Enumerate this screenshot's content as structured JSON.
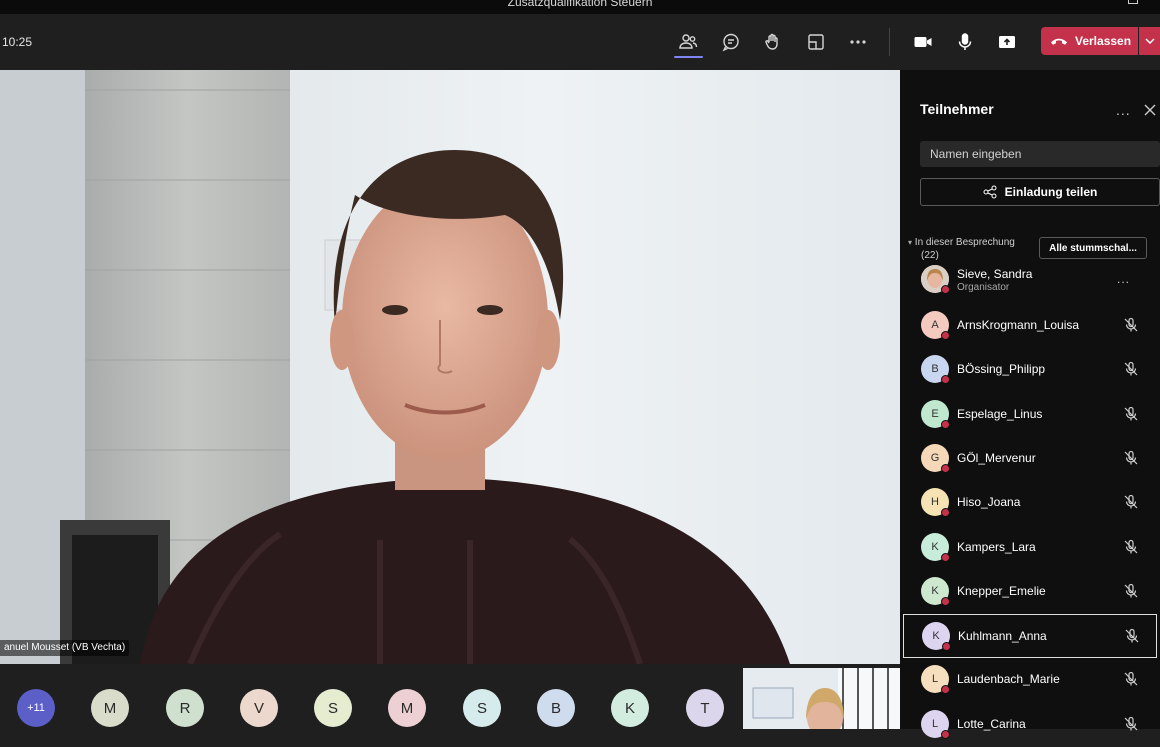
{
  "window": {
    "title": "Zusatzqualifikation Steuern"
  },
  "toolbar": {
    "timer": "10:25",
    "leave_label": "Verlassen",
    "icons": [
      "people-icon",
      "chat-icon",
      "raise-hand-icon",
      "rooms-icon",
      "more-icon",
      "camera-icon",
      "mic-icon",
      "share-icon"
    ]
  },
  "video": {
    "speaker_name": "anuel Mousset (VB Vechta)"
  },
  "strip": {
    "more_label": "+11",
    "avatars": [
      {
        "initial": "M",
        "color": "#d9dccb"
      },
      {
        "initial": "R",
        "color": "#cfe0cf"
      },
      {
        "initial": "V",
        "color": "#ecd8cc"
      },
      {
        "initial": "S",
        "color": "#e6ecd0"
      },
      {
        "initial": "M",
        "color": "#ecd0d4"
      },
      {
        "initial": "S",
        "color": "#d6ecec"
      },
      {
        "initial": "B",
        "color": "#cfdced"
      },
      {
        "initial": "K",
        "color": "#d3ece0"
      },
      {
        "initial": "T",
        "color": "#dcd6ec"
      }
    ]
  },
  "panel": {
    "title": "Teilnehmer",
    "more": "...",
    "search_placeholder": "Namen eingeben",
    "invite_label": "Einladung teilen",
    "section_label": "In dieser Besprechung",
    "section_count": "(22)",
    "mute_all_label": "Alle stummschal...",
    "organizer": {
      "name": "Sieve, Sandra",
      "role": "Organisator"
    },
    "participants": [
      {
        "name": "ArnsKrogmann_Louisa",
        "initial": "A",
        "color": "#f4c9c0"
      },
      {
        "name": "BÖssing_Philipp",
        "initial": "B",
        "color": "#c9d6f0"
      },
      {
        "name": "Espelage_Linus",
        "initial": "E",
        "color": "#bfe8cf"
      },
      {
        "name": "GÖl_Mervenur",
        "initial": "G",
        "color": "#f5d8b8"
      },
      {
        "name": "Hiso_Joana",
        "initial": "H",
        "color": "#f6e3b3"
      },
      {
        "name": "Kampers_Lara",
        "initial": "K",
        "color": "#c7ecd9"
      },
      {
        "name": "Knepper_Emelie",
        "initial": "K",
        "color": "#cde8cf"
      },
      {
        "name": "Kuhlmann_Anna",
        "initial": "K",
        "color": "#ddd5ef",
        "selected": true
      },
      {
        "name": "Laudenbach_Marie",
        "initial": "L",
        "color": "#f6dfbe"
      },
      {
        "name": "Lotte_Carina",
        "initial": "L",
        "color": "#ddd5ef"
      }
    ]
  }
}
